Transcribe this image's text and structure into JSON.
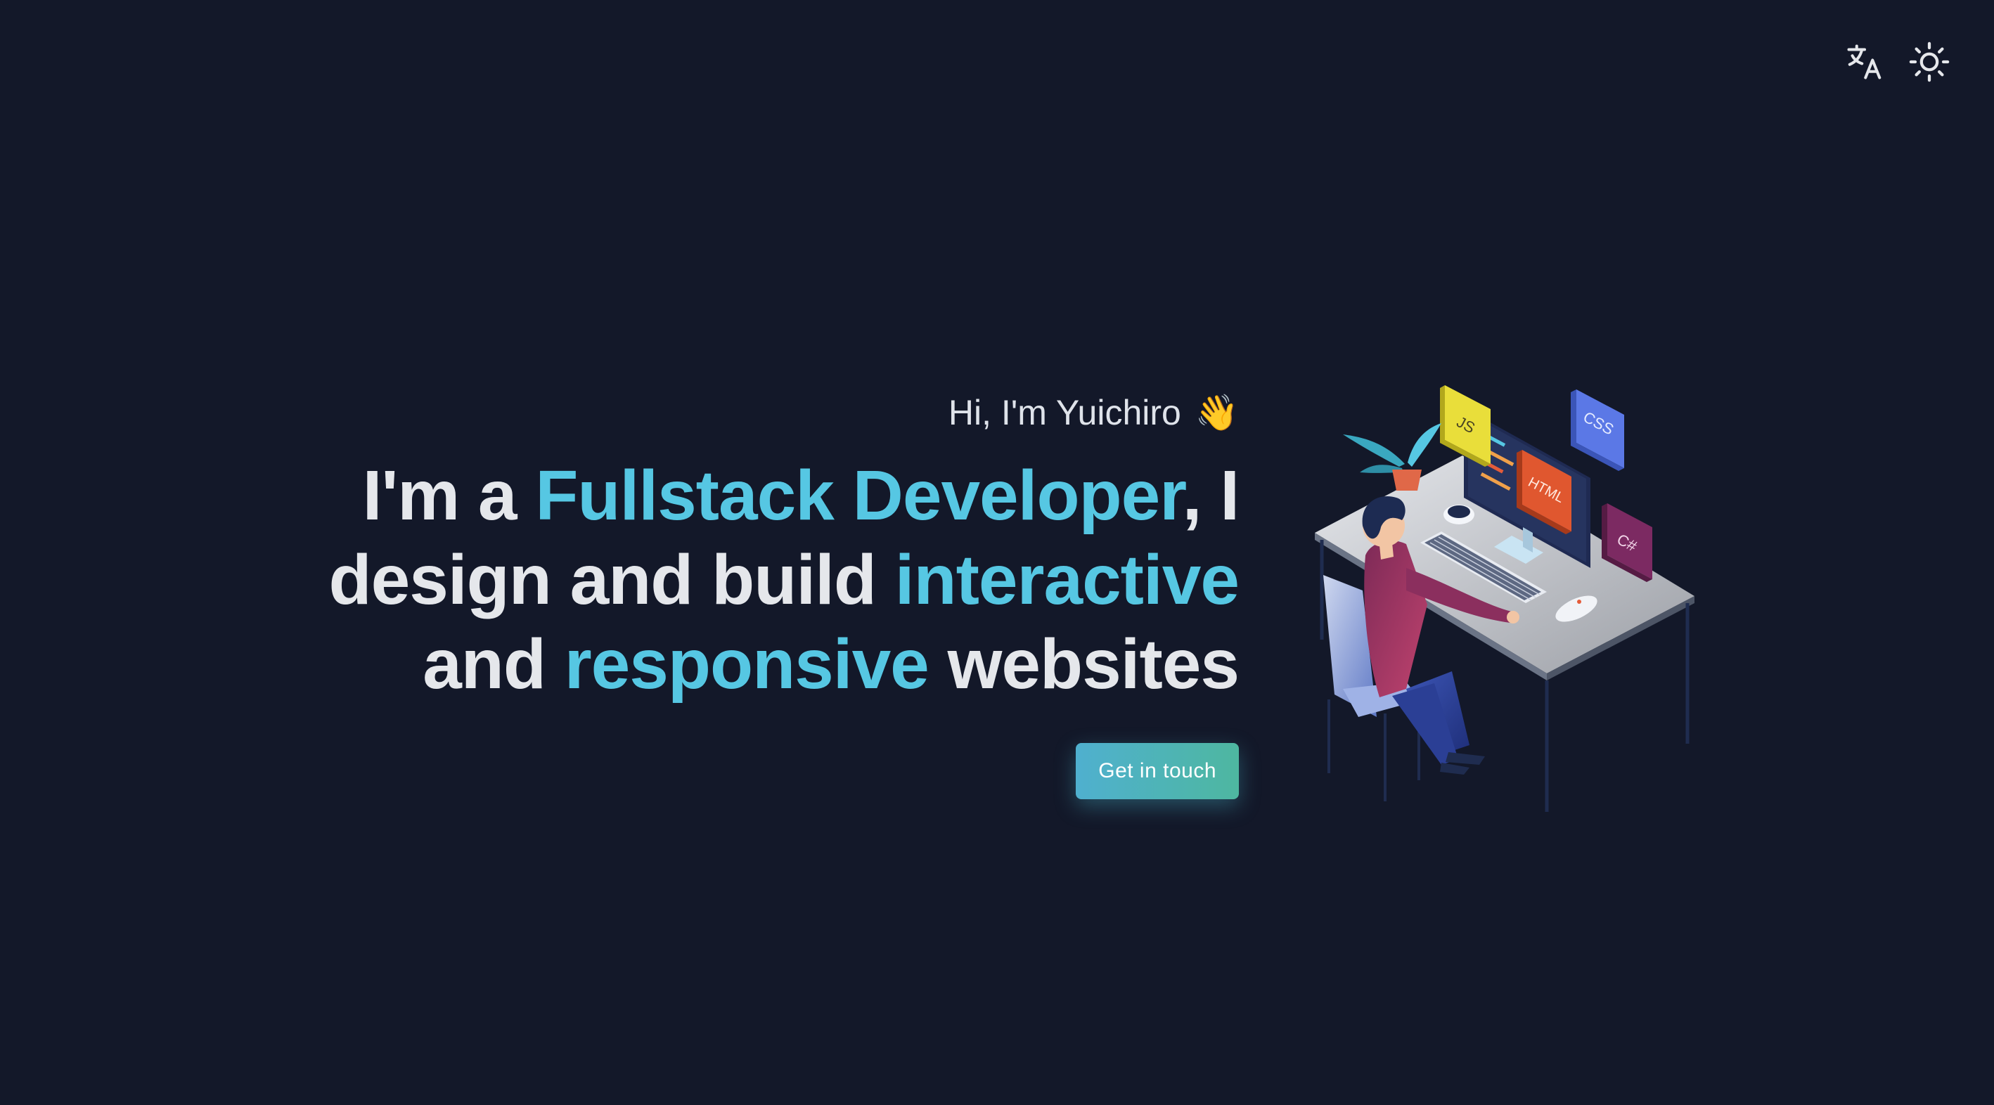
{
  "toolbar": {
    "language_icon": "translate-icon",
    "theme_icon": "sun-icon"
  },
  "hero": {
    "greeting": "Hi, I'm Yuichiro",
    "greeting_emoji": "👋",
    "headline": {
      "part1": "I'm a ",
      "highlight1": "Fullstack Developer",
      "part2": ", I design and build ",
      "highlight2": "interactive",
      "part3": " and ",
      "highlight3": "responsive",
      "part4": " websites"
    },
    "cta_label": "Get in touch"
  },
  "illustration": {
    "badges": [
      "JS",
      "CSS",
      "HTML",
      "C#"
    ]
  },
  "colors": {
    "background": "#131829",
    "accent": "#56c7e3",
    "button_start": "#4fb0cf",
    "button_end": "#4eb7a0"
  }
}
